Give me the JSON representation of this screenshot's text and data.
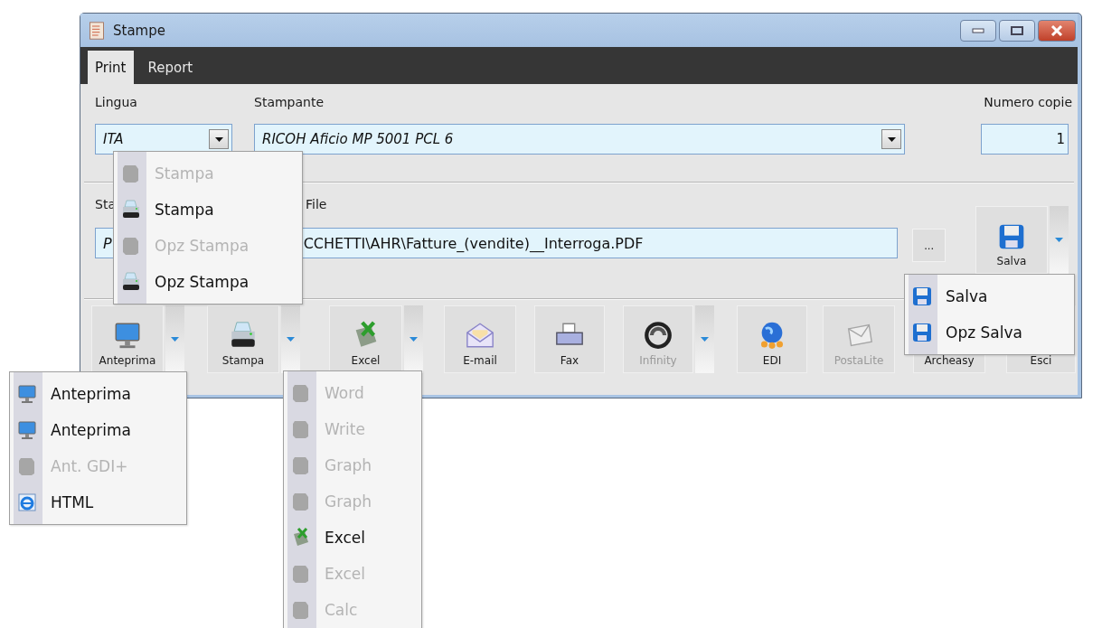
{
  "window": {
    "title": "Stampe"
  },
  "tabs": [
    {
      "label": "Print",
      "selected": true
    },
    {
      "label": "Report",
      "selected": false
    }
  ],
  "lingua": {
    "label": "Lingua",
    "value": "ITA"
  },
  "stampante": {
    "label": "Stampante",
    "value": "RICOH Aficio MP 5001 PCL 6"
  },
  "numero_copie": {
    "label": "Numero copie",
    "value": "1"
  },
  "file": {
    "label_start": "Sta",
    "label_end": "File",
    "value_start": "P",
    "value_end": "CCHETTI\\AHR\\Fatture_(vendite)__Interroga.PDF",
    "browse": "..."
  },
  "salva_button": {
    "label": "Salva"
  },
  "toolbar": [
    {
      "label": "Anteprima",
      "disabled": false,
      "dropdown": true
    },
    {
      "label": "Stampa",
      "disabled": false,
      "dropdown": true
    },
    {
      "label": "Excel",
      "disabled": false,
      "dropdown": true
    },
    {
      "label": "E-mail",
      "disabled": false,
      "dropdown": false
    },
    {
      "label": "Fax",
      "disabled": false,
      "dropdown": false
    },
    {
      "label": "Infinity",
      "disabled": true,
      "dropdown": true
    },
    {
      "label": "EDI",
      "disabled": false,
      "dropdown": false
    },
    {
      "label": "PostaLite",
      "disabled": true,
      "dropdown": false
    },
    {
      "label": "Archeasy",
      "disabled": false,
      "dropdown": false
    },
    {
      "label": "Esci",
      "disabled": false,
      "dropdown": false
    }
  ],
  "stampa_menu": [
    {
      "label": "Stampa",
      "disabled": true
    },
    {
      "label": "Stampa",
      "disabled": false
    },
    {
      "label": "Opz Stampa",
      "disabled": true
    },
    {
      "label": "Opz Stampa",
      "disabled": false
    }
  ],
  "salva_menu": [
    {
      "label": "Salva",
      "disabled": false
    },
    {
      "label": "Opz Salva",
      "disabled": false
    }
  ],
  "anteprima_menu": [
    {
      "label": "Anteprima",
      "disabled": false
    },
    {
      "label": "Anteprima",
      "disabled": false
    },
    {
      "label": "Ant. GDI+",
      "disabled": true
    },
    {
      "label": "HTML",
      "disabled": false
    }
  ],
  "excel_menu": [
    {
      "label": "Word",
      "disabled": true
    },
    {
      "label": "Write",
      "disabled": true
    },
    {
      "label": "Graph",
      "disabled": true
    },
    {
      "label": "Graph",
      "disabled": true
    },
    {
      "label": "Excel",
      "disabled": false
    },
    {
      "label": "Excel",
      "disabled": true
    },
    {
      "label": "Calc",
      "disabled": true
    }
  ]
}
